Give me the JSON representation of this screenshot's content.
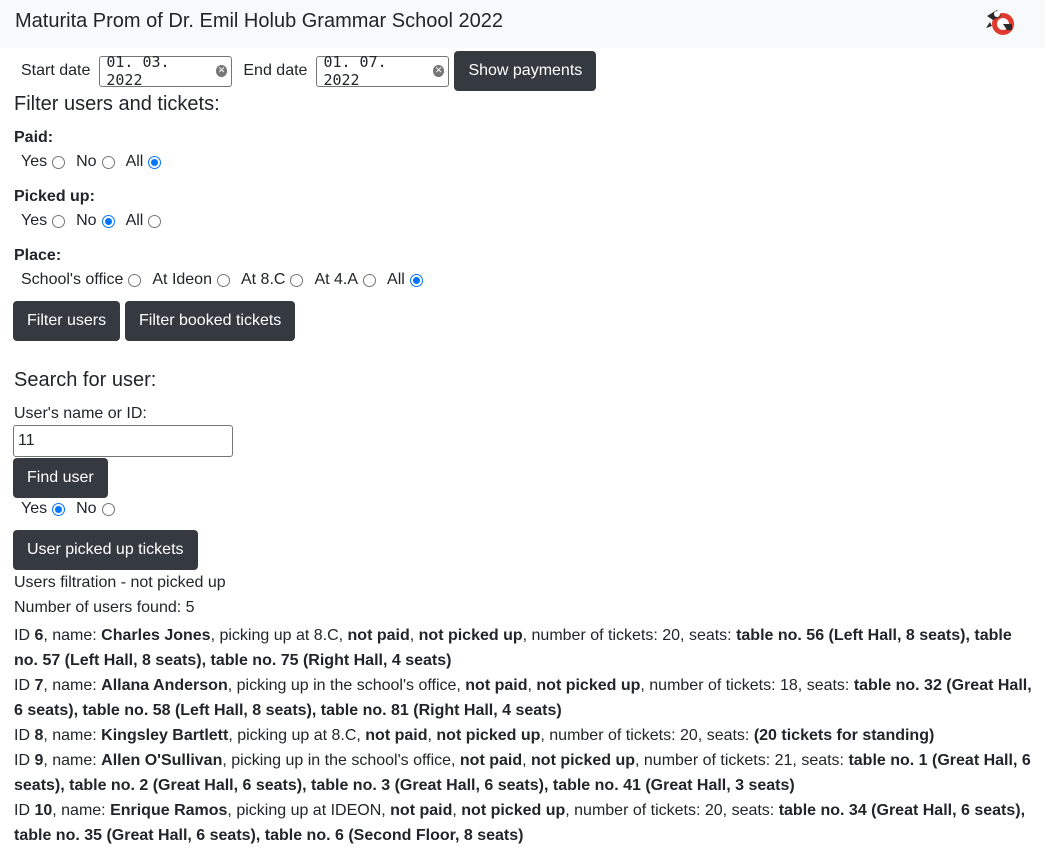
{
  "header": {
    "title": "Maturita Prom of Dr. Emil Holub Grammar School 2022"
  },
  "payments": {
    "start_label": "Start date",
    "start_value": "01. 03. 2022",
    "end_label": "End date",
    "end_value": "01. 07. 2022",
    "show_button": "Show payments"
  },
  "filter": {
    "heading": "Filter users and tickets:",
    "paid": {
      "label": "Paid:",
      "options": [
        "Yes",
        "No",
        "All"
      ],
      "selected": "All"
    },
    "picked": {
      "label": "Picked up:",
      "options": [
        "Yes",
        "No",
        "All"
      ],
      "selected": "No"
    },
    "place": {
      "label": "Place:",
      "options": [
        "School's office",
        "At Ideon",
        "At 8.C",
        "At 4.A",
        "All"
      ],
      "selected": "All"
    },
    "filter_users_button": "Filter users",
    "filter_tickets_button": "Filter booked tickets"
  },
  "search": {
    "heading": "Search for user:",
    "field_label": "User's name or ID:",
    "field_value": "11",
    "find_button": "Find user",
    "picked_options": [
      "Yes",
      "No"
    ],
    "picked_selected": "Yes",
    "picked_button": "User picked up tickets"
  },
  "results": {
    "filtration_text": "Users filtration - not picked up",
    "count_text": "Number of users found: 5",
    "users": [
      {
        "id": "6",
        "name": "Charles Jones",
        "pickup": "picking up at 8.C",
        "paid": "not paid",
        "picked": "not picked up",
        "tickets": "20",
        "seats": "table no. 56 (Left Hall, 8 seats), table no. 57 (Left Hall, 8 seats), table no. 75 (Right Hall, 4 seats)"
      },
      {
        "id": "7",
        "name": "Allana Anderson",
        "pickup": "picking up in the school's office",
        "paid": "not paid",
        "picked": "not picked up",
        "tickets": "18",
        "seats": "table no. 32 (Great Hall, 6 seats), table no. 58 (Left Hall, 8 seats), table no. 81 (Right Hall, 4 seats)"
      },
      {
        "id": "8",
        "name": "Kingsley Bartlett",
        "pickup": "picking up at 8.C",
        "paid": "not paid",
        "picked": "not picked up",
        "tickets": "20",
        "seats": "(20 tickets for standing)"
      },
      {
        "id": "9",
        "name": "Allen O'Sullivan",
        "pickup": "picking up in the school's office",
        "paid": "not paid",
        "picked": "not picked up",
        "tickets": "21",
        "seats": "table no. 1 (Great Hall, 6 seats), table no. 2 (Great Hall, 6 seats), table no. 3 (Great Hall, 6 seats), table no. 41 (Great Hall, 3 seats)"
      },
      {
        "id": "10",
        "name": "Enrique Ramos",
        "pickup": "picking up at IDEON",
        "paid": "not paid",
        "picked": "not picked up",
        "tickets": "20",
        "seats": "table no. 34 (Great Hall, 6 seats), table no. 35 (Great Hall, 6 seats), table no. 6 (Second Floor, 8 seats)"
      }
    ]
  },
  "colors": {
    "button_bg": "#343a40",
    "radio_selected": "#0075ff",
    "topbar_bg": "#f8f9fa",
    "logo_red": "#e03a2f"
  },
  "icons": {
    "logo": "school-logo-icon",
    "clear": "clear-icon"
  }
}
